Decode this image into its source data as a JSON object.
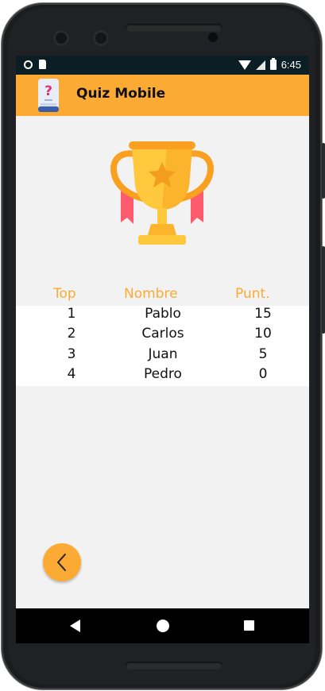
{
  "status_bar": {
    "time": "6:45",
    "icons": [
      "circle-notification-icon",
      "sd-card-icon",
      "wifi-icon",
      "signal-icon",
      "battery-icon"
    ]
  },
  "app_bar": {
    "title": "Quiz Mobile",
    "logo_icon": "quiz-phone-question-icon",
    "background": "#fbab34"
  },
  "hero": {
    "icon": "trophy-icon"
  },
  "leaderboard": {
    "headers": {
      "rank": "Top",
      "name": "Nombre",
      "score": "Punt."
    },
    "rows": [
      {
        "rank": "1",
        "name": "Pablo",
        "score": "15"
      },
      {
        "rank": "2",
        "name": "Carlos",
        "score": "10"
      },
      {
        "rank": "3",
        "name": "Juan",
        "score": "5"
      },
      {
        "rank": "4",
        "name": "Pedro",
        "score": "0"
      }
    ]
  },
  "back_button": {
    "icon": "chevron-left-icon"
  },
  "nav_bar": {
    "icons": [
      "nav-back-icon",
      "nav-home-icon",
      "nav-recents-icon"
    ]
  },
  "colors": {
    "accent": "#fbab34",
    "screen_background": "#f2f2f2",
    "status_bar": "#0b1e24"
  }
}
